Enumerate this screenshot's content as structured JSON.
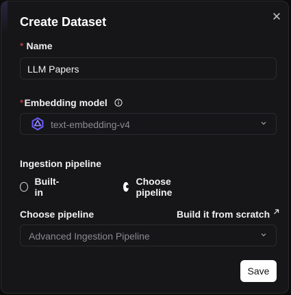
{
  "dialog": {
    "title": "Create Dataset",
    "close_glyph": "✕"
  },
  "name": {
    "required_mark": "*",
    "label": "Name",
    "value": "LLM Papers"
  },
  "embedding": {
    "required_mark": "*",
    "label": "Embedding model",
    "selected": "text-embedding-v4",
    "icon": "model-logo-icon"
  },
  "ingestion": {
    "label": "Ingestion pipeline",
    "options": [
      {
        "label": "Built-in",
        "selected": false
      },
      {
        "label": "Choose pipeline",
        "selected": true
      }
    ]
  },
  "pipeline": {
    "label": "Choose pipeline",
    "link_label": "Build it from scratch",
    "selected": "Advanced Ingestion Pipeline"
  },
  "actions": {
    "save_label": "Save"
  },
  "colors": {
    "required": "#e5484d",
    "accent_logo": "#6b5cff",
    "background": "#161618"
  }
}
